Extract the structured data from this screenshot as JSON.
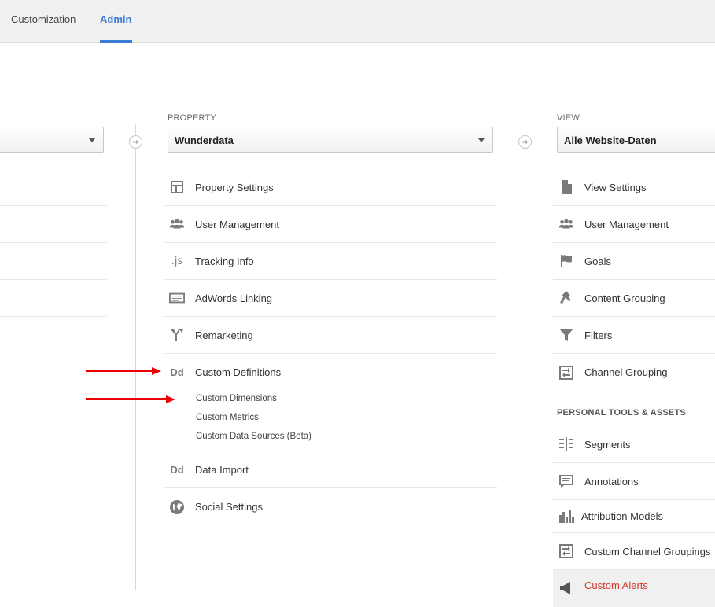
{
  "tabs": [
    {
      "label": "Customization"
    },
    {
      "label": "Admin"
    }
  ],
  "property": {
    "section_label": "PROPERTY",
    "selected": "Wunderdata",
    "items": [
      {
        "label": "Property Settings",
        "icon": "property-settings-icon"
      },
      {
        "label": "User Management",
        "icon": "users-icon"
      },
      {
        "label": "Tracking Info",
        "icon": "js-icon",
        "glyph": ".js"
      },
      {
        "label": "AdWords Linking",
        "icon": "adwords-linking-icon"
      },
      {
        "label": "Remarketing",
        "icon": "remarketing-icon"
      },
      {
        "label": "Custom Definitions",
        "icon": "dd-icon",
        "glyph": "Dd"
      },
      {
        "label": "Data Import",
        "icon": "dd-icon",
        "glyph": "Dd"
      },
      {
        "label": "Social Settings",
        "icon": "globe-icon"
      }
    ],
    "subitems": [
      "Custom Dimensions",
      "Custom Metrics",
      "Custom Data Sources (Beta)"
    ]
  },
  "view": {
    "section_label": "VIEW",
    "selected": "Alle Website-Daten",
    "items": [
      {
        "label": "View Settings",
        "icon": "document-icon"
      },
      {
        "label": "User Management",
        "icon": "users-icon"
      },
      {
        "label": "Goals",
        "icon": "flag-icon"
      },
      {
        "label": "Content Grouping",
        "icon": "content-grouping-icon"
      },
      {
        "label": "Filters",
        "icon": "filter-icon"
      },
      {
        "label": "Channel Grouping",
        "icon": "channel-grouping-icon"
      }
    ],
    "tools_heading": "PERSONAL TOOLS & ASSETS",
    "tools": [
      {
        "label": "Segments",
        "icon": "segments-icon"
      },
      {
        "label": "Annotations",
        "icon": "annotations-icon"
      },
      {
        "label": "Attribution Models",
        "icon": "bar-chart-icon"
      },
      {
        "label": "Custom Channel Groupings",
        "icon": "channel-grouping-icon"
      },
      {
        "label": "Custom Alerts",
        "icon": "megaphone-icon"
      }
    ]
  },
  "colors": {
    "accent": "#3a7bd5",
    "arrow": "#ee0000",
    "alert": "#d03a2a"
  }
}
